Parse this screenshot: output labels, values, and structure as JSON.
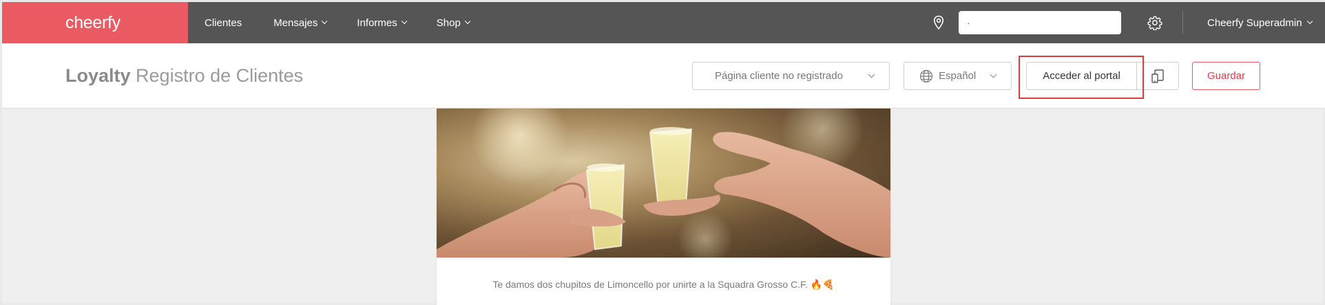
{
  "brand": {
    "logo_text": "cheerfy",
    "color": "#e95a62"
  },
  "nav": {
    "items": [
      {
        "label": "Clientes",
        "has_dropdown": false
      },
      {
        "label": "Mensajes",
        "has_dropdown": true
      },
      {
        "label": "Informes",
        "has_dropdown": true
      },
      {
        "label": "Shop",
        "has_dropdown": true
      }
    ]
  },
  "topbar": {
    "location_icon": "map-pin-icon",
    "store_value": "·",
    "settings_icon": "gear-icon",
    "user_label": "Cheerfy Superadmin",
    "background": "#555555"
  },
  "header": {
    "title_bold": "Loyalty",
    "title_rest": "Registro de Clientes",
    "page_select": "Página cliente no registrado",
    "language_select": "Español",
    "portal_button": "Acceder al portal",
    "save_button": "Guardar"
  },
  "content": {
    "hero_image_alt": "Dos manos brindando con chupitos de limoncello",
    "caption": "Te damos dos chupitos de Limoncello por unirte a la Squadra Grosso C.F. 🔥🍕"
  }
}
